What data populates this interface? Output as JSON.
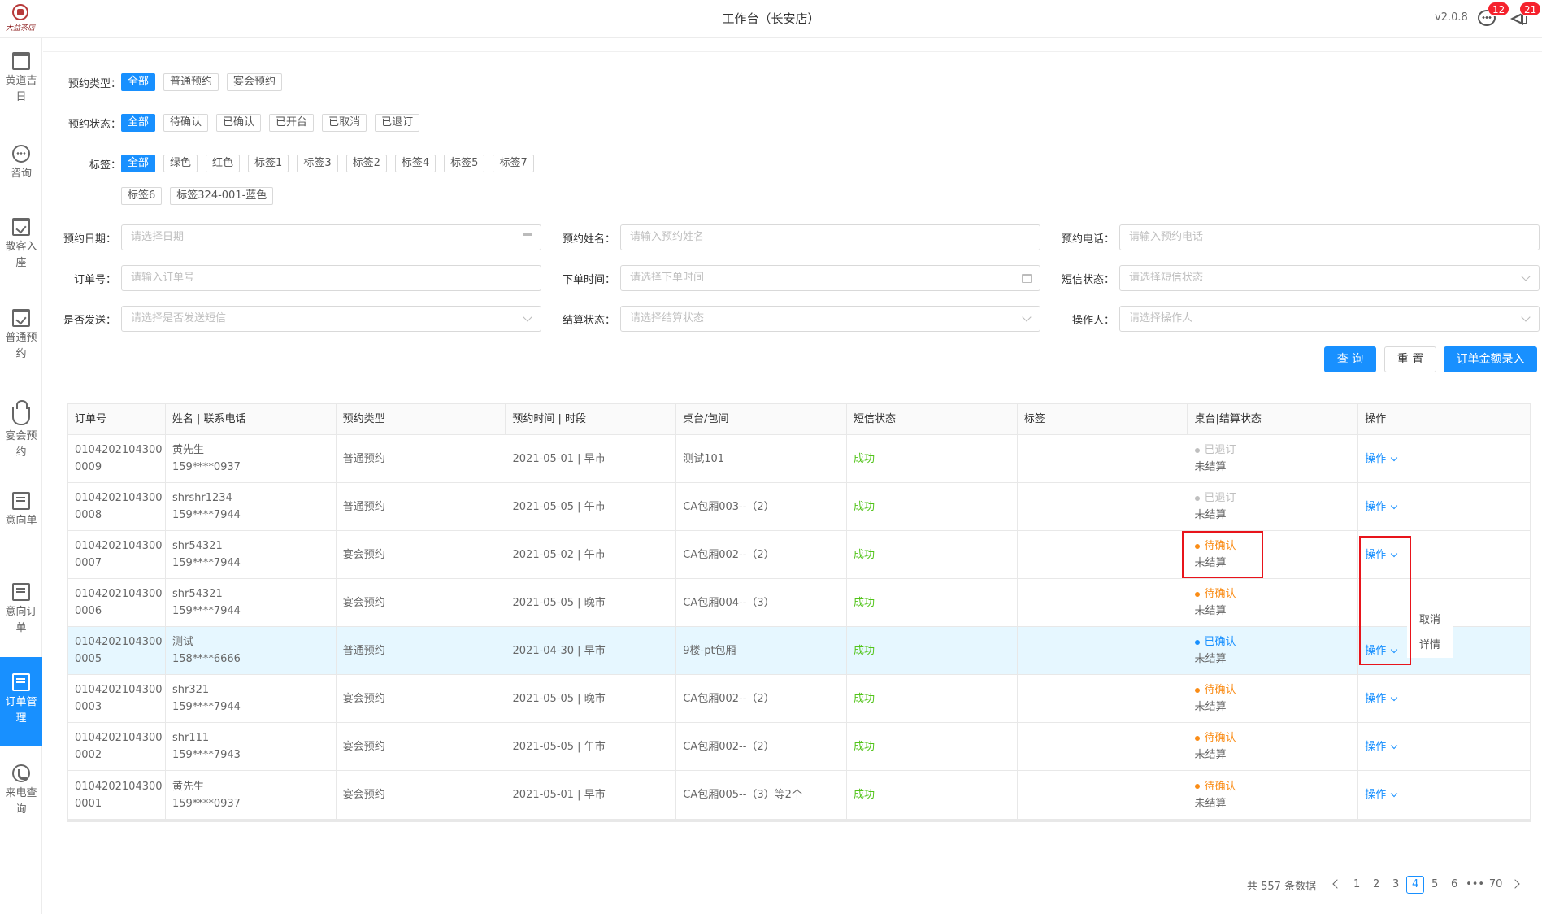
{
  "header": {
    "logo_text": "大益茶店",
    "title": "工作台（长安店）",
    "version": "v2.0.8",
    "messages_badge": "12",
    "notices_badge": "21"
  },
  "sidebar": {
    "items": [
      {
        "label": "黄道吉日",
        "icon": "calendar-icon"
      },
      {
        "label": "咨询",
        "icon": "chat-icon"
      },
      {
        "label": "散客入座",
        "icon": "checkin-icon"
      },
      {
        "label": "普通预约",
        "icon": "booking-icon"
      },
      {
        "label": "宴会预约",
        "icon": "crown-icon"
      },
      {
        "label": "意向单",
        "icon": "intent-icon"
      },
      {
        "label": "意向订单",
        "icon": "intent-order-icon"
      },
      {
        "label": "订单管理",
        "icon": "order-icon",
        "active": true
      },
      {
        "label": "来电查询",
        "icon": "phone-icon"
      }
    ]
  },
  "filters": {
    "booking_type": {
      "label": "预约类型：",
      "options": [
        "全部",
        "普通预约",
        "宴会预约"
      ],
      "selected": "全部"
    },
    "booking_status": {
      "label": "预约状态：",
      "options": [
        "全部",
        "待确认",
        "已确认",
        "已开台",
        "已取消",
        "已退订"
      ],
      "selected": "全部"
    },
    "tags": {
      "label": "标签：",
      "options": [
        "全部",
        "绿色",
        "红色",
        "标签1",
        "标签3",
        "标签2",
        "标签4",
        "标签5",
        "标签7",
        "标签6",
        "标签324-001-蓝色"
      ],
      "selected": "全部"
    }
  },
  "form": {
    "booking_date": {
      "label": "预约日期：",
      "placeholder": "请选择日期"
    },
    "booking_name": {
      "label": "预约姓名：",
      "placeholder": "请输入预约姓名"
    },
    "booking_phone": {
      "label": "预约电话：",
      "placeholder": "请输入预约电话"
    },
    "order_no": {
      "label": "订单号：",
      "placeholder": "请输入订单号"
    },
    "order_time": {
      "label": "下单时间：",
      "placeholder": "请选择下单时间"
    },
    "sms_status": {
      "label": "短信状态：",
      "placeholder": "请选择短信状态"
    },
    "send_sms": {
      "label": "是否发送：",
      "placeholder": "请选择是否发送短信"
    },
    "settle_status": {
      "label": "结算状态：",
      "placeholder": "请选择结算状态"
    },
    "operator": {
      "label": "操作人：",
      "placeholder": "请选择操作人"
    }
  },
  "buttons": {
    "query": "查 询",
    "reset": "重 置",
    "amount_entry": "订单金额录入"
  },
  "table": {
    "headers": [
      "订单号",
      "姓名 | 联系电话",
      "预约类型",
      "预约时间 | 时段",
      "桌台/包间",
      "短信状态",
      "标签",
      "桌台|结算状态",
      "操作"
    ],
    "rows": [
      {
        "order1": "0104202104300",
        "order2": "0009",
        "name": "黄先生",
        "phone": "159****0937",
        "type": "普通预约",
        "time": "2021-05-01 | 早市",
        "table": "测试101",
        "sms": "成功",
        "label": "",
        "state": "已退订",
        "state_color": "grey",
        "settle": "未结算",
        "op": "操作"
      },
      {
        "order1": "0104202104300",
        "order2": "0008",
        "name": "shrshr1234",
        "phone": "159****7944",
        "type": "普通预约",
        "time": "2021-05-05 | 午市",
        "table": "CA包厢003--（2）",
        "sms": "成功",
        "label": "",
        "state": "已退订",
        "state_color": "grey",
        "settle": "未结算",
        "op": "操作"
      },
      {
        "order1": "0104202104300",
        "order2": "0007",
        "name": "shr54321",
        "phone": "159****7944",
        "type": "宴会预约",
        "time": "2021-05-02 | 午市",
        "table": "CA包厢002--（2）",
        "sms": "成功",
        "label": "",
        "state": "待确认",
        "state_color": "orange",
        "settle": "未结算",
        "op": "操作"
      },
      {
        "order1": "0104202104300",
        "order2": "0006",
        "name": "shr54321",
        "phone": "159****7944",
        "type": "宴会预约",
        "time": "2021-05-05 | 晚市",
        "table": "CA包厢004--（3）",
        "sms": "成功",
        "label": "",
        "state": "待确认",
        "state_color": "orange",
        "settle": "未结算",
        "op": ""
      },
      {
        "order1": "0104202104300",
        "order2": "0005",
        "name": "测试",
        "phone": "158****6666",
        "type": "普通预约",
        "time": "2021-04-30 | 早市",
        "table": "9楼-pt包厢",
        "sms": "成功",
        "label": "",
        "state": "已确认",
        "state_color": "blue",
        "settle": "未结算",
        "op": "操作",
        "highlight": true
      },
      {
        "order1": "0104202104300",
        "order2": "0003",
        "name": "shr321",
        "phone": "159****7944",
        "type": "宴会预约",
        "time": "2021-05-05 | 晚市",
        "table": "CA包厢002--（2）",
        "sms": "成功",
        "label": "",
        "state": "待确认",
        "state_color": "orange",
        "settle": "未结算",
        "op": "操作"
      },
      {
        "order1": "0104202104300",
        "order2": "0002",
        "name": "shr111",
        "phone": "159****7943",
        "type": "宴会预约",
        "time": "2021-05-05 | 午市",
        "table": "CA包厢002--（2）",
        "sms": "成功",
        "label": "",
        "state": "待确认",
        "state_color": "orange",
        "settle": "未结算",
        "op": "操作"
      },
      {
        "order1": "0104202104300",
        "order2": "0001",
        "name": "黄先生",
        "phone": "159****0937",
        "type": "宴会预约",
        "time": "2021-05-01 | 早市",
        "table": "CA包厢005--（3）等2个",
        "sms": "成功",
        "label": "",
        "state": "待确认",
        "state_color": "orange",
        "settle": "未结算",
        "op": "操作"
      }
    ]
  },
  "op_menu": {
    "items": [
      "取消",
      "详情"
    ]
  },
  "pagination": {
    "total_text": "共 557 条数据",
    "pages": [
      "1",
      "2",
      "3",
      "4",
      "5",
      "6",
      "•••",
      "70"
    ],
    "current": "4"
  },
  "colors": {
    "primary": "#1890ff",
    "success": "#52c41a",
    "warning": "#fa8c16",
    "annotation": "#e8141b"
  }
}
